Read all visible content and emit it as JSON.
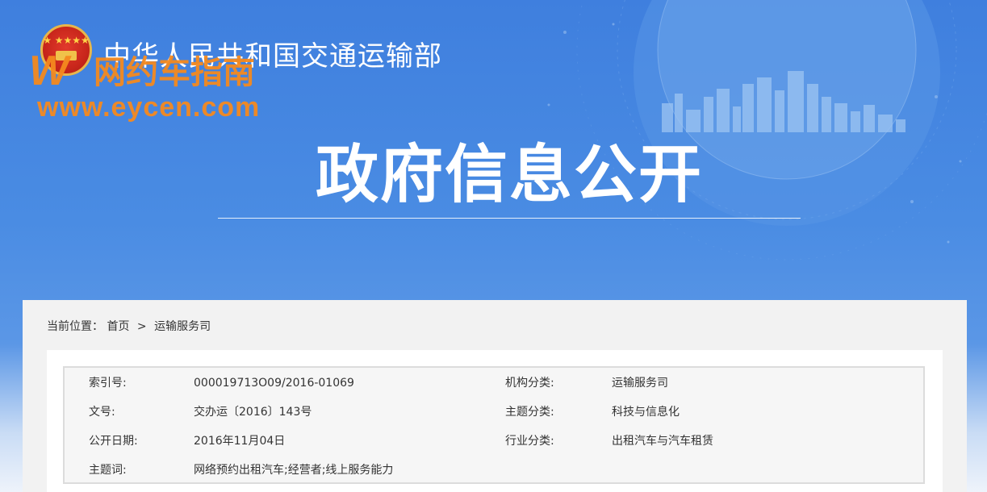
{
  "header": {
    "ministry_title": "中华人民共和国交通运输部",
    "watermark": {
      "letter": "W",
      "cn": "网约车指南",
      "url": "www.eycen.com"
    },
    "page_heading": "政府信息公开"
  },
  "breadcrumb": {
    "prefix": "当前位置：",
    "items": [
      "首页",
      "运输服务司"
    ],
    "separator": ">"
  },
  "meta": {
    "rows": [
      {
        "label1": "索引号:",
        "value1": "000019713O09/2016-01069",
        "label2": "机构分类:",
        "value2": "运输服务司"
      },
      {
        "label1": "文号:",
        "value1": "交办运〔2016〕143号",
        "label2": "主题分类:",
        "value2": "科技与信息化"
      },
      {
        "label1": "公开日期:",
        "value1": "2016年11月04日",
        "label2": "行业分类:",
        "value2": "出租汽车与汽车租赁"
      },
      {
        "label1": "主题词:",
        "value1": "网络预约出租汽车;经营者;线上服务能力",
        "label2": "",
        "value2": ""
      }
    ]
  },
  "colors": {
    "banner_blue": "#4a8ae0",
    "watermark_orange": "#f58a1f",
    "panel_gray": "#f2f2f2"
  }
}
